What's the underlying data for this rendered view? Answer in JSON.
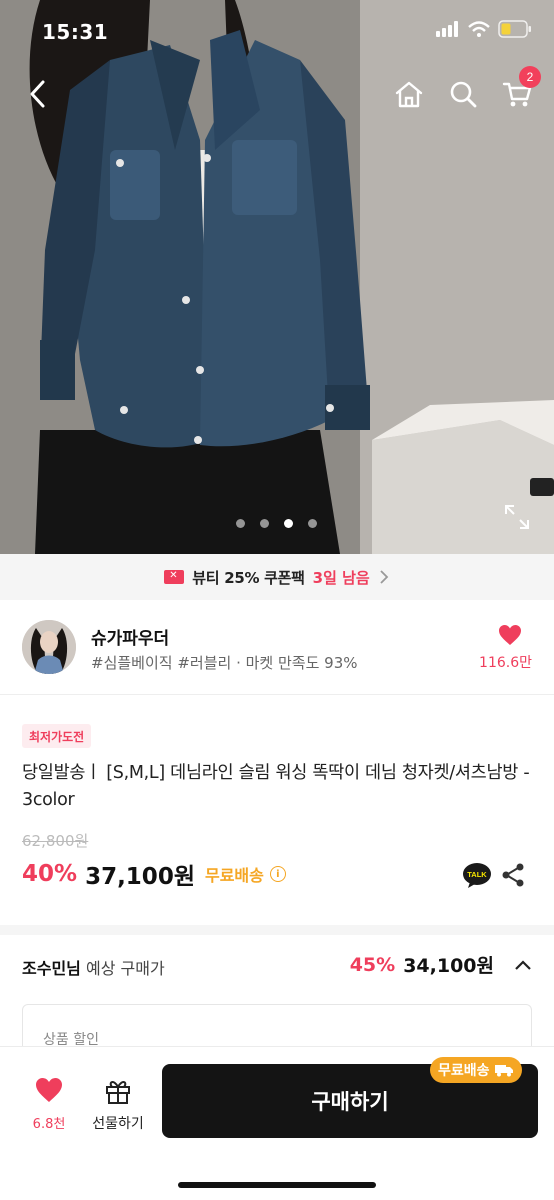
{
  "status_bar": {
    "time": "15:31"
  },
  "nav": {
    "cart_count": "2"
  },
  "coupon": {
    "text": "뷰티 25% 쿠폰팩",
    "days_left": "3일 남음"
  },
  "shop": {
    "name": "슈가파우더",
    "meta": "#심플베이직 #러블리 · 마켓 만족도 93%",
    "likes": "116.6만"
  },
  "product": {
    "badge": "최저가도전",
    "title": "당일발송ㅣ [S,M,L] 데님라인 슬림 워싱 똑딱이 데님 청자켓/셔츠남방 - 3color",
    "original_price": "62,800원",
    "discount": "40%",
    "price": "37,100원",
    "shipping": "무료배송"
  },
  "expected": {
    "user": "조수민님",
    "label": "예상 구매가",
    "discount": "45%",
    "price": "34,100원"
  },
  "discount_box": {
    "label": "상품 할인"
  },
  "bottom": {
    "wish_count": "6.8천",
    "gift_label": "선물하기",
    "buy_label": "구매하기",
    "ship_badge": "무료배송"
  },
  "colors": {
    "accent": "#ef3e5c",
    "shipping": "#f5a623",
    "buy_button": "#141414"
  },
  "carousel": {
    "pages": 4,
    "active": 3
  }
}
